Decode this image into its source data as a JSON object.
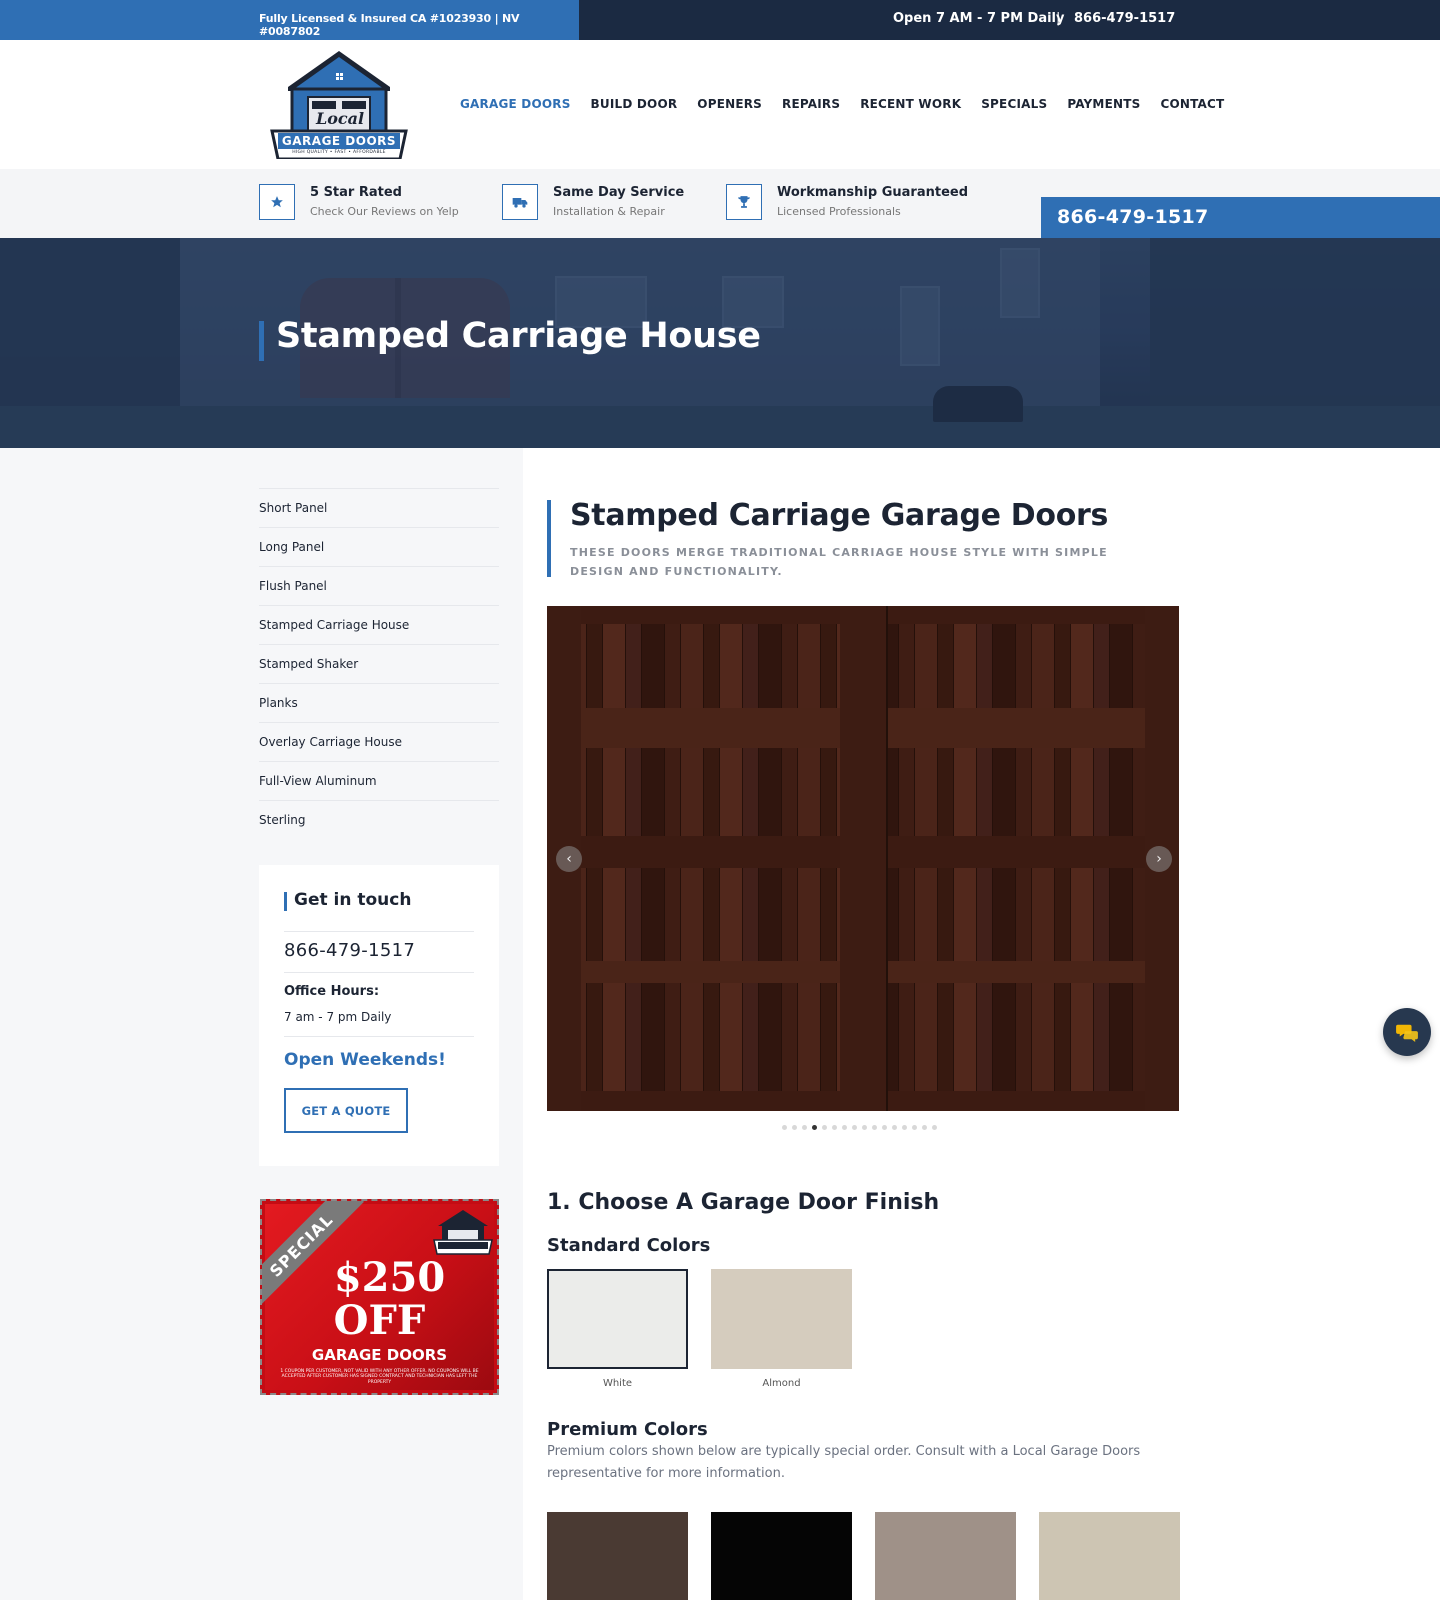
{
  "topbar": {
    "license": "Fully Licensed & Insured CA #1023930 | NV #0087802",
    "hours": "Open 7 AM - 7 PM Daily",
    "separator": "|",
    "phone": "866-479-1517"
  },
  "logo": {
    "brand_top": "Local",
    "brand_main": "GARAGE DOORS",
    "tagline": "HIGH QUALITY • FAST • AFFORDABLE"
  },
  "nav": {
    "items": [
      {
        "label": "GARAGE DOORS",
        "active": true
      },
      {
        "label": "BUILD DOOR",
        "active": false
      },
      {
        "label": "OPENERS",
        "active": false
      },
      {
        "label": "REPAIRS",
        "active": false
      },
      {
        "label": "RECENT WORK",
        "active": false
      },
      {
        "label": "SPECIALS",
        "active": false
      },
      {
        "label": "PAYMENTS",
        "active": false
      },
      {
        "label": "CONTACT",
        "active": false
      }
    ]
  },
  "features": [
    {
      "icon": "star-icon",
      "title": "5 Star Rated",
      "subtitle": "Check Our Reviews on Yelp"
    },
    {
      "icon": "truck-icon",
      "title": "Same Day Service",
      "subtitle": "Installation & Repair"
    },
    {
      "icon": "trophy-icon",
      "title": "Workmanship Guaranteed",
      "subtitle": "Licensed Professionals"
    }
  ],
  "call_box": {
    "phone": "866-479-1517"
  },
  "hero": {
    "title": "Stamped Carriage House"
  },
  "sidebar": {
    "menu": [
      "Short Panel",
      "Long Panel",
      "Flush Panel",
      "Stamped Carriage House",
      "Stamped Shaker",
      "Planks",
      "Overlay Carriage House",
      "Full-View Aluminum",
      "Sterling"
    ],
    "contact": {
      "title": "Get in touch",
      "phone": "866-479-1517",
      "hours_label": "Office Hours:",
      "hours_value": "7 am - 7 pm Daily",
      "weekends": "Open Weekends!",
      "quote_button": "GET A QUOTE"
    },
    "special": {
      "ribbon": "SPECIAL",
      "amount": "$250",
      "off": "OFF",
      "product": "GARAGE DOORS",
      "fine_print": "1 COUPON PER CUSTOMER, NOT VALID WITH ANY OTHER OFFER. NO COUPONS WILL BE ACCEPTED AFTER CUSTOMER HAS SIGNED CONTRACT AND TECHNICIAN HAS LEFT THE PROPERTY"
    }
  },
  "main": {
    "title": "Stamped Carriage Garage Doors",
    "subtitle": "These doors merge traditional carriage house style with simple design and functionality.",
    "slider": {
      "slide_count": 16,
      "active_slide": 4,
      "prev_label": "‹",
      "next_label": "›"
    },
    "finish_heading": "1. Choose A Garage Door Finish",
    "standard_heading": "Standard Colors",
    "standard_colors": [
      {
        "name": "White",
        "color": "#ebecea",
        "selected": true
      },
      {
        "name": "Almond",
        "color": "#d5ccbe",
        "selected": false
      }
    ],
    "premium_heading": "Premium Colors",
    "premium_description": "Premium colors shown below are typically special order. Consult with a Local Garage Doors representative for more information.",
    "premium_colors": [
      {
        "color": "#4a3a33"
      },
      {
        "color": "#050505"
      },
      {
        "color": "#9f9188"
      },
      {
        "color": "#cdc5b3"
      }
    ]
  },
  "colors": {
    "accent": "#2f6fb4",
    "dark": "#1b2a42",
    "text": "#1c2433"
  }
}
